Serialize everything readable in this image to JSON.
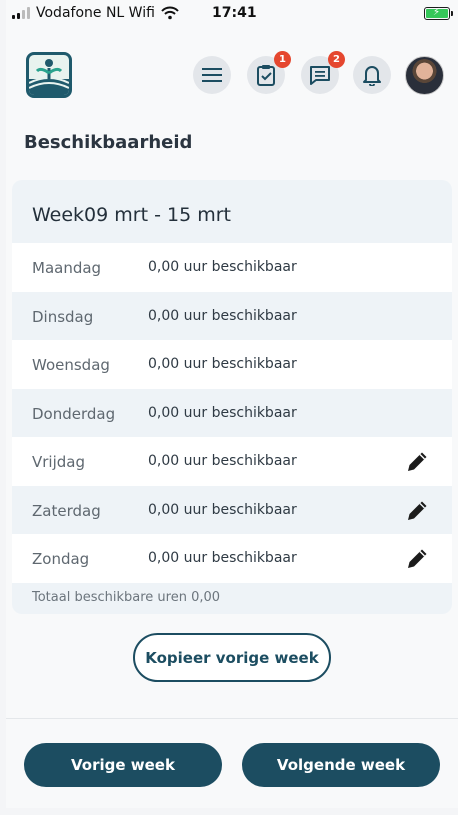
{
  "status_bar": {
    "carrier": "Vodafone NL Wifi",
    "time": "17:41"
  },
  "header": {
    "menu_icon": "hamburger-icon",
    "tasks_icon": "clipboard-check-icon",
    "tasks_badge": "1",
    "messages_icon": "chat-icon",
    "messages_badge": "2",
    "notifications_icon": "bell-icon"
  },
  "page_title": "Beschikbaarheid",
  "week": {
    "title": "Week09 mrt - 15 mrt",
    "days": [
      {
        "name": "Maandag",
        "hours": "0,00 uur beschikbaar",
        "editable": false
      },
      {
        "name": "Dinsdag",
        "hours": "0,00 uur beschikbaar",
        "editable": false
      },
      {
        "name": "Woensdag",
        "hours": "0,00 uur beschikbaar",
        "editable": false
      },
      {
        "name": "Donderdag",
        "hours": "0,00 uur beschikbaar",
        "editable": false
      },
      {
        "name": "Vrijdag",
        "hours": "0,00 uur beschikbaar",
        "editable": true
      },
      {
        "name": "Zaterdag",
        "hours": "0,00 uur beschikbaar",
        "editable": true
      },
      {
        "name": "Zondag",
        "hours": "0,00 uur beschikbaar",
        "editable": true
      }
    ],
    "total": "Totaal beschikbare uren 0,00"
  },
  "actions": {
    "copy_previous": "Kopieer vorige week",
    "previous_week": "Vorige week",
    "next_week": "Volgende week"
  },
  "colors": {
    "primary": "#1c4d61",
    "badge": "#e5472f",
    "battery": "#35c759"
  }
}
